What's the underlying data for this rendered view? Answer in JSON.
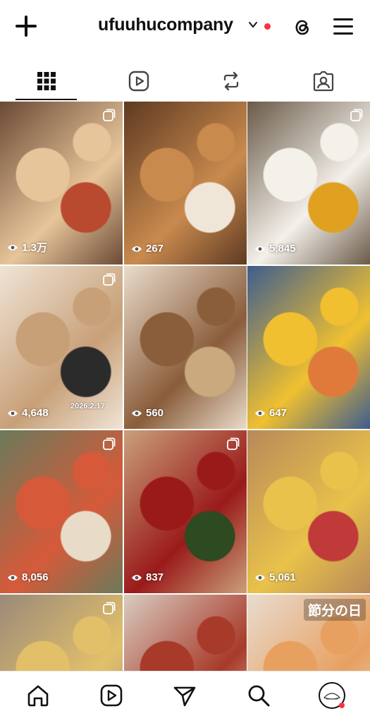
{
  "header": {
    "username": "ufuuhucompany",
    "new_icon": "plus-icon",
    "threads_icon": "threads-icon",
    "menu_icon": "hamburger-menu-icon"
  },
  "tabs": [
    {
      "icon": "grid-icon",
      "active": true
    },
    {
      "icon": "reels-icon",
      "active": false
    },
    {
      "icon": "reposts-icon",
      "active": false
    },
    {
      "icon": "tagged-icon",
      "active": false
    }
  ],
  "posts": [
    {
      "views": "1.3万",
      "multi": true,
      "colors": [
        "#6b4a36",
        "#e7c59a",
        "#b94a2f"
      ]
    },
    {
      "views": "267",
      "multi": false,
      "colors": [
        "#5e3a22",
        "#c98a4e",
        "#f0e6d8"
      ]
    },
    {
      "views": "5,845",
      "multi": true,
      "colors": [
        "#6a5a48",
        "#f4f0ea",
        "#e0a020"
      ]
    },
    {
      "views": "4,648",
      "multi": true,
      "colors": [
        "#efe4d6",
        "#c8a078",
        "#2b2b2b"
      ],
      "caption": "2026.2.17"
    },
    {
      "views": "560",
      "multi": false,
      "colors": [
        "#e9dccb",
        "#8a5d3b",
        "#c9a97d"
      ]
    },
    {
      "views": "647",
      "multi": false,
      "colors": [
        "#3e5d8e",
        "#f0c030",
        "#e07a3a"
      ]
    },
    {
      "views": "8,056",
      "multi": true,
      "colors": [
        "#6a7a5a",
        "#d65a3a",
        "#e8dcc8"
      ]
    },
    {
      "views": "837",
      "multi": true,
      "colors": [
        "#c9a07a",
        "#9a1a1a",
        "#2d4a20"
      ]
    },
    {
      "views": "5,061",
      "multi": false,
      "colors": [
        "#b8895a",
        "#e8c24a",
        "#c03a3a"
      ]
    },
    {
      "views": "",
      "multi": true,
      "colors": [
        "#9a8a7a",
        "#e2c06a",
        "#4a5a6a"
      ]
    },
    {
      "views": "",
      "multi": false,
      "colors": [
        "#d8ccc0",
        "#a83a2a",
        "#3a7a2a"
      ]
    },
    {
      "views": "",
      "multi": false,
      "colors": [
        "#e8dcd0",
        "#e8a060",
        "#c84040"
      ],
      "caption": "節分の日"
    }
  ],
  "bottom_nav": [
    {
      "icon": "home-icon"
    },
    {
      "icon": "reels-icon"
    },
    {
      "icon": "send-icon"
    },
    {
      "icon": "search-icon"
    },
    {
      "icon": "profile-avatar-icon"
    }
  ],
  "colors": {
    "notification_dot": "#ff3040",
    "text": "#111111"
  }
}
